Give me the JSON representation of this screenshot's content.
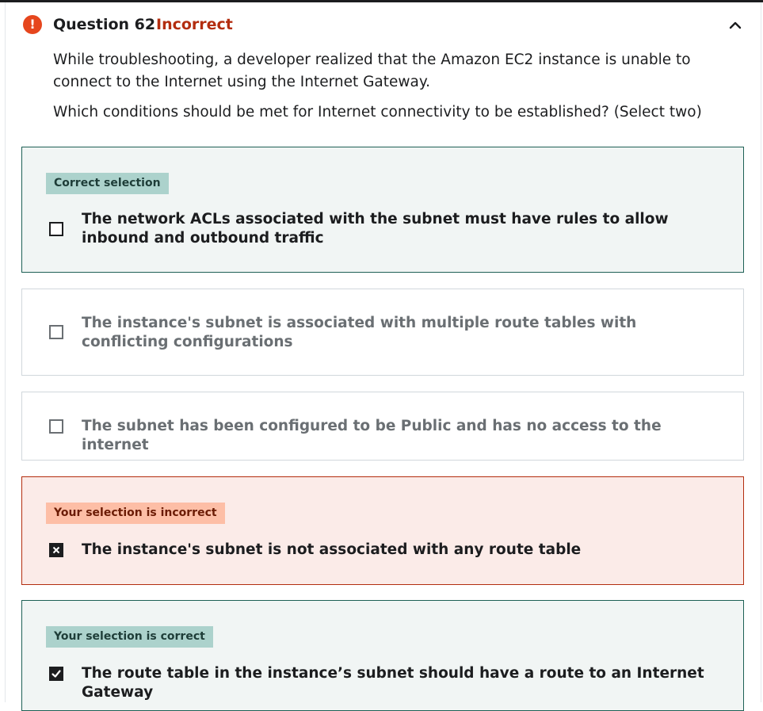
{
  "question": {
    "title": "Question 62",
    "status": "Incorrect",
    "prompt_line_1": "While troubleshooting, a developer realized that the Amazon EC2 instance is unable to connect to the Internet using the Internet Gateway.",
    "prompt_line_2": "Which conditions should be met for Internet connectivity to be established? (Select two)"
  },
  "options": [
    {
      "badge": "Correct selection",
      "text": "The network ACLs associated with the subnet must have rules to allow inbound and outbound traffic",
      "checked": false,
      "state": "correct-selection"
    },
    {
      "text": "The instance's subnet is associated with multiple route tables with conflicting configurations",
      "checked": false,
      "state": "neutral"
    },
    {
      "text": "The subnet has been configured to be Public and has no access to the internet",
      "checked": false,
      "state": "neutral"
    },
    {
      "badge": "Your selection is incorrect",
      "text": "The instance's subnet is not associated with any route table",
      "checked": true,
      "state": "incorrect"
    },
    {
      "badge": "Your selection is correct",
      "text": "The route table in the instance’s subnet should have a route to an Internet Gateway",
      "checked": true,
      "state": "correct"
    }
  ],
  "colors": {
    "incorrect_accent": "#b32d0f",
    "alert_icon": "#e6461d",
    "correct_border": "#1e6055",
    "correct_badge": "#acd2cc",
    "incorrect_badge": "#fdbea6"
  },
  "icons": {
    "status": "alert-circle-icon",
    "collapse": "chevron-up-icon",
    "checked_correct": "checkmark-icon",
    "checked_incorrect": "x-mark-icon"
  }
}
